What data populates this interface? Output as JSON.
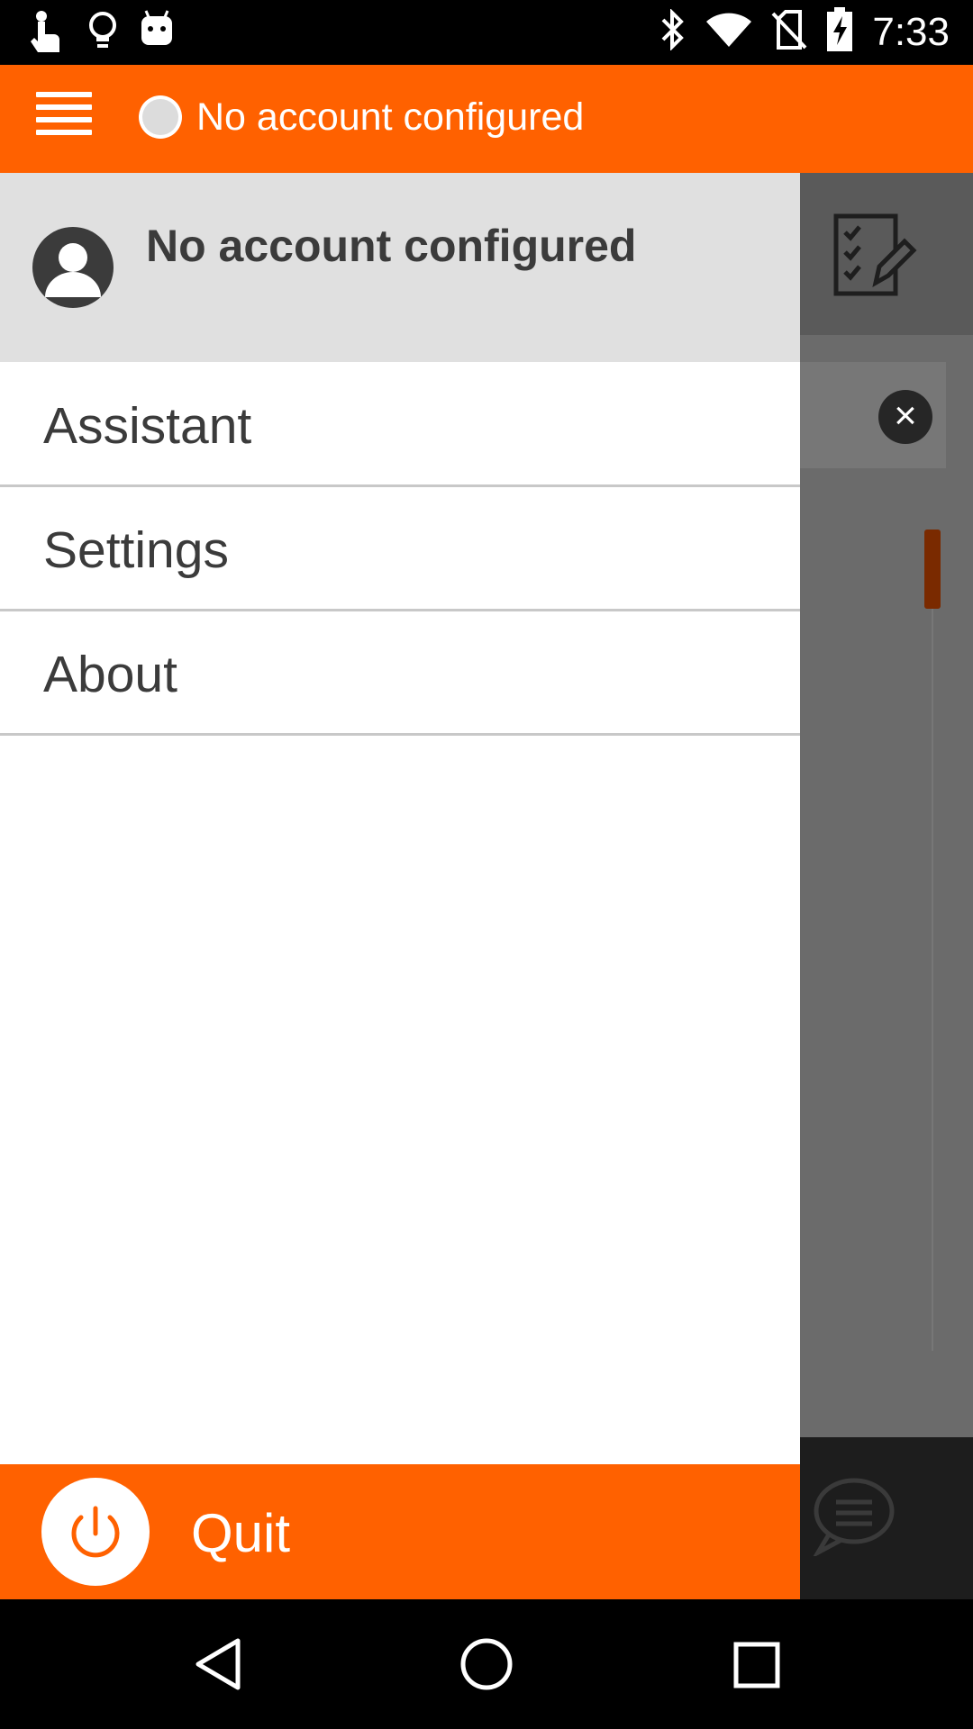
{
  "status_bar": {
    "time": "7:33",
    "left_icons": [
      "touch-icon",
      "lightbulb-icon",
      "android-icon"
    ],
    "right_icons": [
      "bluetooth-icon",
      "wifi-icon",
      "no-sim-icon",
      "battery-charging-icon"
    ]
  },
  "app_bar": {
    "menu_icon": "hamburger-menu-icon",
    "status_indicator": "status-dot",
    "title": "No account configured"
  },
  "drawer": {
    "header": {
      "avatar_icon": "user-avatar-icon",
      "account_label": "No account configured"
    },
    "items": [
      {
        "label": "Assistant"
      },
      {
        "label": "Settings"
      },
      {
        "label": "About"
      }
    ],
    "quit": {
      "icon": "power-icon",
      "label": "Quit"
    }
  },
  "background": {
    "icons": [
      "checklist-edit-icon",
      "close-icon",
      "chat-icon"
    ]
  },
  "nav_bar": {
    "buttons": [
      "back-icon",
      "home-icon",
      "recents-icon"
    ]
  },
  "colors": {
    "accent": "#ff6100",
    "drawer_header_bg": "#e0e0e0",
    "text_dark": "#3b3b3b"
  }
}
